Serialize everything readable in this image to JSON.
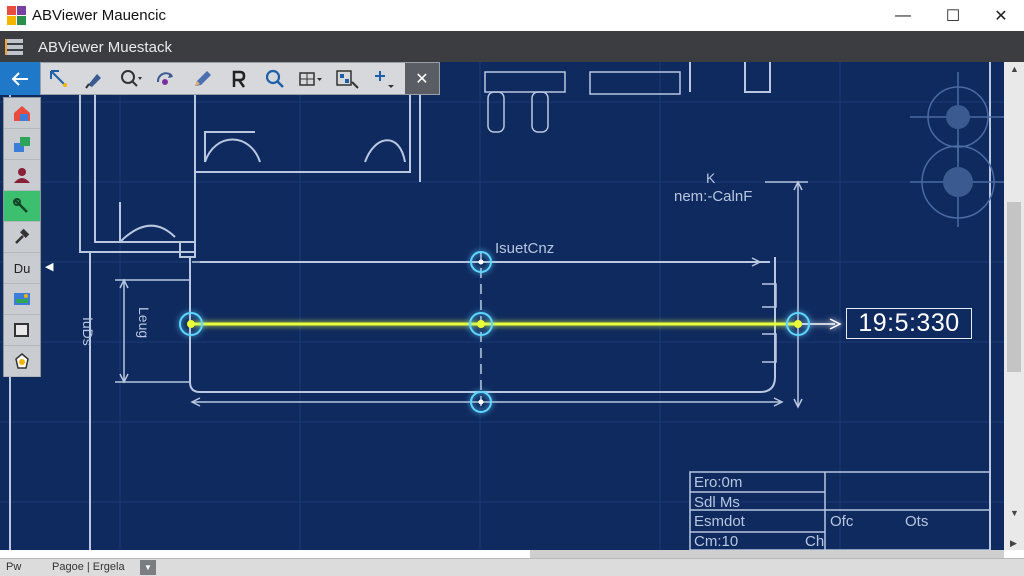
{
  "window": {
    "title": "ABViewer Mauencic",
    "controls": {
      "minimize": "—",
      "maximize": "☐",
      "close": "✕"
    }
  },
  "document": {
    "title": "ABViewer Muestack"
  },
  "toolbar": {
    "tools": [
      "select-arrow-icon",
      "pan-icon",
      "zoom-in-icon",
      "orbit-icon",
      "pencil-icon",
      "rotate-icon",
      "zoom-icon",
      "grid-icon",
      "snap-icon",
      "add-point-icon"
    ],
    "close_label": "✕"
  },
  "palette": {
    "items": [
      {
        "icon": "home-layers-icon",
        "label": ""
      },
      {
        "icon": "layers-icon",
        "label": ""
      },
      {
        "icon": "user-icon",
        "label": ""
      },
      {
        "icon": "measure-icon",
        "label": ""
      },
      {
        "icon": "hammer-icon",
        "label": ""
      },
      {
        "icon": "text-icon",
        "label": "Du"
      },
      {
        "icon": "image-icon",
        "label": ""
      },
      {
        "icon": "rectangle-icon",
        "label": ""
      },
      {
        "icon": "stamp-icon",
        "label": ""
      }
    ],
    "active_index": 3
  },
  "drawing": {
    "label_top_k": "K",
    "label_top_right": "nem:-CalnF",
    "label_mid": "IsuetCnz",
    "label_left_vertical": "IuDs",
    "label_left_vertical2": "Leug",
    "measurement_readout": "19:5:330",
    "title_block": {
      "row1": "Ero:0m",
      "row2": "Sdl Ms",
      "row3": "Esmdot",
      "row4": "Cm:10",
      "cell_mid": "Ofc",
      "cell_mid2": "Ots",
      "cell_right": "Ch"
    }
  },
  "statusbar": {
    "left": "Pw",
    "center": "Pagoe | Ergela"
  },
  "colors": {
    "canvas": "#0f2a5f",
    "line": "#b9c7e0",
    "measure": "#e8ff3a",
    "node": "#5fd6ff",
    "accent": "#1f78c8"
  }
}
